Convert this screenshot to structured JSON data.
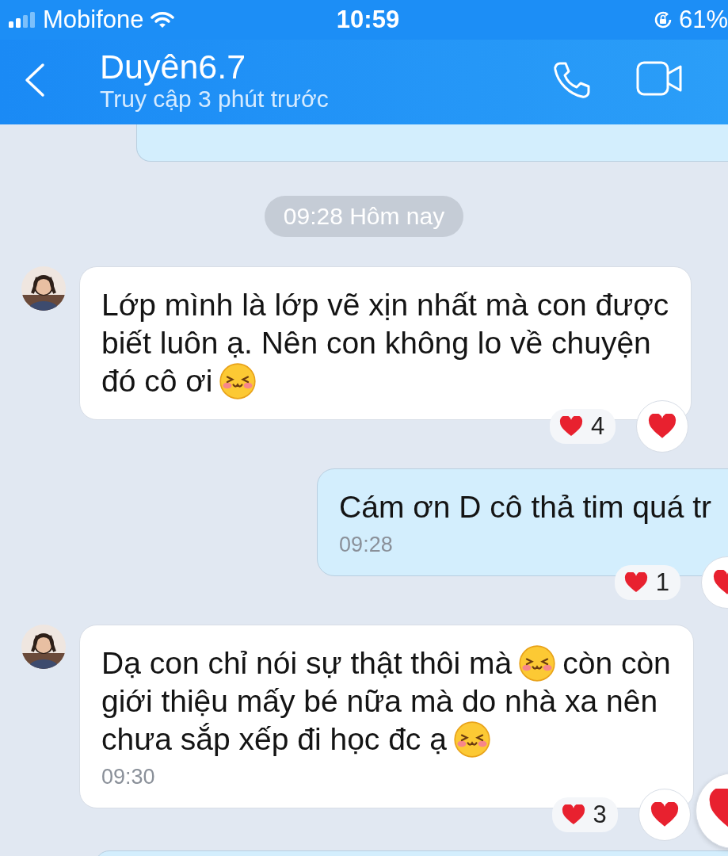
{
  "status_bar": {
    "carrier": "Mobifone",
    "time": "10:59",
    "battery": "61%"
  },
  "header": {
    "title": "Duyên6.7",
    "subtitle": "Truy cập 3 phút trước"
  },
  "items": [
    {
      "kind": "partial",
      "outgoing": true
    },
    {
      "kind": "separator",
      "text": "09:28 Hôm nay"
    },
    {
      "kind": "message",
      "outgoing": false,
      "lines": [
        [
          {
            "kind": "text",
            "text": "Lớp mình là lớp vẽ xịn nhất mà con được"
          }
        ],
        [
          {
            "kind": "text",
            "text": "biết luôn ạ. Nên con không lo về chuyện"
          }
        ],
        [
          {
            "kind": "text",
            "text": "đó cô ơi"
          },
          {
            "kind": "emoji"
          }
        ]
      ],
      "reaction_count": "4",
      "burst": false
    },
    {
      "kind": "message",
      "outgoing": true,
      "lines": [
        [
          {
            "kind": "text",
            "text": "Cám ơn D cô thả tim quá tr"
          }
        ]
      ],
      "time": "09:28",
      "reaction_count": "1",
      "burst": false
    },
    {
      "kind": "message",
      "outgoing": false,
      "lines": [
        [
          {
            "kind": "text",
            "text": "Dạ con chỉ nói sự thật thôi mà"
          },
          {
            "kind": "emoji"
          },
          {
            "kind": "text",
            "text": "còn còn"
          }
        ],
        [
          {
            "kind": "text",
            "text": "giới thiệu mấy bé nữa mà do nhà xa nên"
          }
        ],
        [
          {
            "kind": "text",
            "text": "chưa sắp xếp đi học đc ạ"
          },
          {
            "kind": "emoji"
          }
        ]
      ],
      "time": "09:30",
      "reaction_count": "3",
      "burst": true
    },
    {
      "kind": "partial",
      "outgoing": true
    }
  ]
}
